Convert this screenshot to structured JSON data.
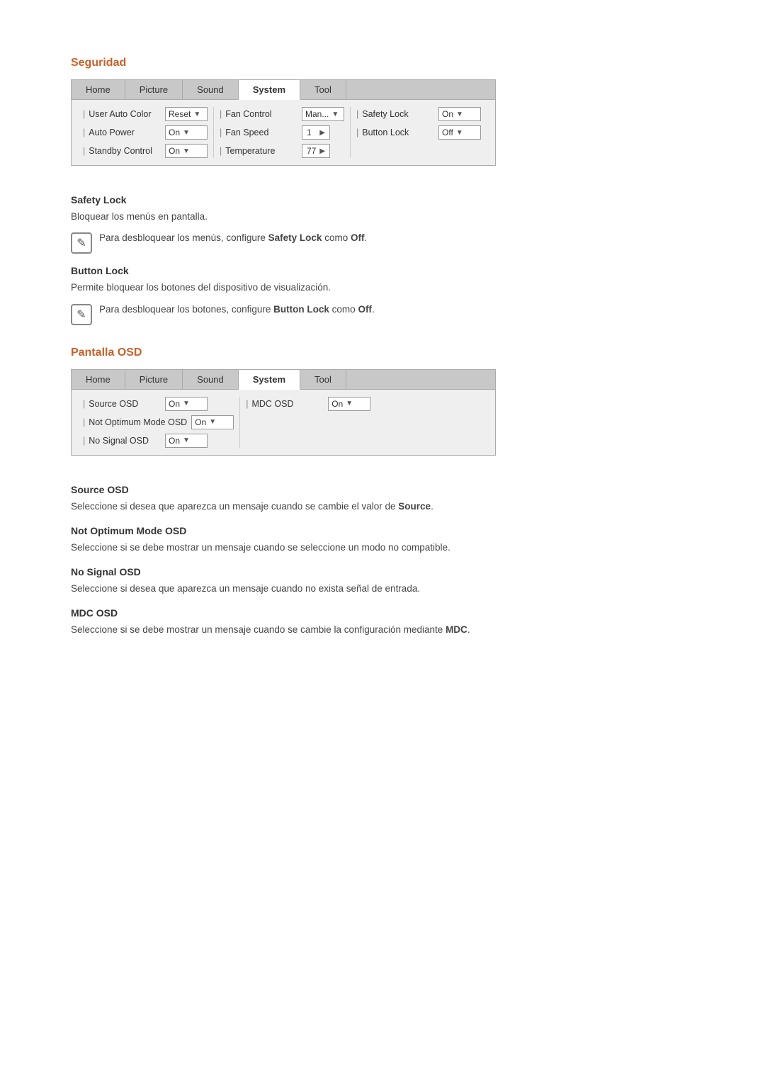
{
  "sections": [
    {
      "id": "seguridad",
      "title": "Seguridad",
      "panel": {
        "tabs": [
          "Home",
          "Picture",
          "Sound",
          "System",
          "Tool"
        ],
        "activeTab": "System",
        "columns": [
          {
            "rows": [
              {
                "label": "User Auto Color",
                "control": "select",
                "value": "Reset",
                "arrow": "▼"
              },
              {
                "label": "Auto Power",
                "control": "select",
                "value": "On",
                "arrow": "▼"
              },
              {
                "label": "Standby Control",
                "control": "select",
                "value": "On",
                "arrow": "▼"
              }
            ]
          },
          {
            "rows": [
              {
                "label": "Fan Control",
                "control": "select",
                "value": "Man...",
                "arrow": "▼"
              },
              {
                "label": "Fan Speed",
                "control": "nav",
                "value": "1",
                "arrow": "▶"
              },
              {
                "label": "Temperature",
                "control": "nav",
                "value": "77",
                "arrow": "▶"
              }
            ]
          },
          {
            "rows": [
              {
                "label": "Safety Lock",
                "control": "select",
                "value": "On",
                "arrow": "▼"
              },
              {
                "label": "Button Lock",
                "control": "select",
                "value": "Off",
                "arrow": "▼"
              }
            ]
          }
        ]
      },
      "items": [
        {
          "heading": "Safety Lock",
          "body": "Bloquear los menús en pantalla.",
          "note": "Para desbloquear los menús, configure Safety Lock como Off.",
          "noteBoldWords": [
            "Safety Lock",
            "Off"
          ]
        },
        {
          "heading": "Button Lock",
          "body": "Permite bloquear los botones del dispositivo de visualización.",
          "note": "Para desbloquear los botones, configure Button Lock como Off.",
          "noteBoldWords": [
            "Button Lock",
            "Off"
          ]
        }
      ]
    },
    {
      "id": "pantalla-osd",
      "title": "Pantalla OSD",
      "panel": {
        "tabs": [
          "Home",
          "Picture",
          "Sound",
          "System",
          "Tool"
        ],
        "activeTab": "System",
        "columns": [
          {
            "rows": [
              {
                "label": "Source OSD",
                "control": "select",
                "value": "On",
                "arrow": "▼"
              },
              {
                "label": "Not Optimum Mode OSD",
                "control": "select",
                "value": "On",
                "arrow": "▼"
              },
              {
                "label": "No Signal OSD",
                "control": "select",
                "value": "On",
                "arrow": "▼"
              }
            ]
          },
          {
            "rows": [
              {
                "label": "MDC OSD",
                "control": "select",
                "value": "On",
                "arrow": "▼"
              }
            ]
          }
        ]
      },
      "items": [
        {
          "heading": "Source OSD",
          "body": "Seleccione si desea que aparezca un mensaje cuando se cambie el valor de Source.",
          "noteBoldWords": [
            "Source"
          ]
        },
        {
          "heading": "Not Optimum Mode OSD",
          "body": "Seleccione si se debe mostrar un mensaje cuando se seleccione un modo no compatible."
        },
        {
          "heading": "No Signal OSD",
          "body": "Seleccione si desea que aparezca un mensaje cuando no exista señal de entrada."
        },
        {
          "heading": "MDC OSD",
          "body": "Seleccione si se debe mostrar un mensaje cuando se cambie la configuración mediante MDC.",
          "noteBoldWords": [
            "MDC"
          ]
        }
      ]
    }
  ]
}
